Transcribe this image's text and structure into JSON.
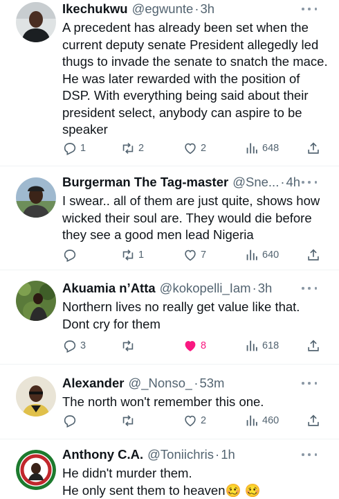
{
  "tweets": [
    {
      "name": "Ikechukwu",
      "handle": "@egwunte",
      "dot": "·",
      "time": "3h",
      "text": "A precedent has already been set when the current deputy senate President allegedly led thugs to invade the senate to snatch the mace. He was later rewarded with the position of DSP. With everything being said about their president select, anybody can aspire to be speaker",
      "replies": "1",
      "retweets": "2",
      "likes": "2",
      "views": "648",
      "liked": false
    },
    {
      "name": "Burgerman The Tag-master",
      "handle": "@Sne...",
      "dot": "·",
      "time": "4h",
      "text": "I swear.. all of them are just quite, shows how wicked their soul are. They would die before they see a good men lead Nigeria",
      "replies": "",
      "retweets": "1",
      "likes": "7",
      "views": "640",
      "liked": false
    },
    {
      "name": "Akuamia n’Atta",
      "handle": "@kokopelli_Iam",
      "dot": "·",
      "time": "3h",
      "text": "Northern lives no really get value like that. Dont cry for them",
      "replies": "3",
      "retweets": "",
      "likes": "8",
      "views": "618",
      "liked": true
    },
    {
      "name": "Alexander",
      "handle": "@_Nonso_",
      "dot": "·",
      "time": "53m",
      "text": "The north won't remember this one.",
      "replies": "",
      "retweets": "",
      "likes": "2",
      "views": "460",
      "liked": false
    },
    {
      "name": "Anthony C.A.",
      "handle": "@Toniichris",
      "dot": "·",
      "time": "1h",
      "text": "He didn't murder them.\nHe only sent them to heaven🥴 🥴",
      "avatar_text": "CONTINUITY OBI-DIENT",
      "liked": false
    }
  ],
  "colors": {
    "like_active": "#f91880",
    "muted": "#536471",
    "divider": "#eff3f4"
  }
}
